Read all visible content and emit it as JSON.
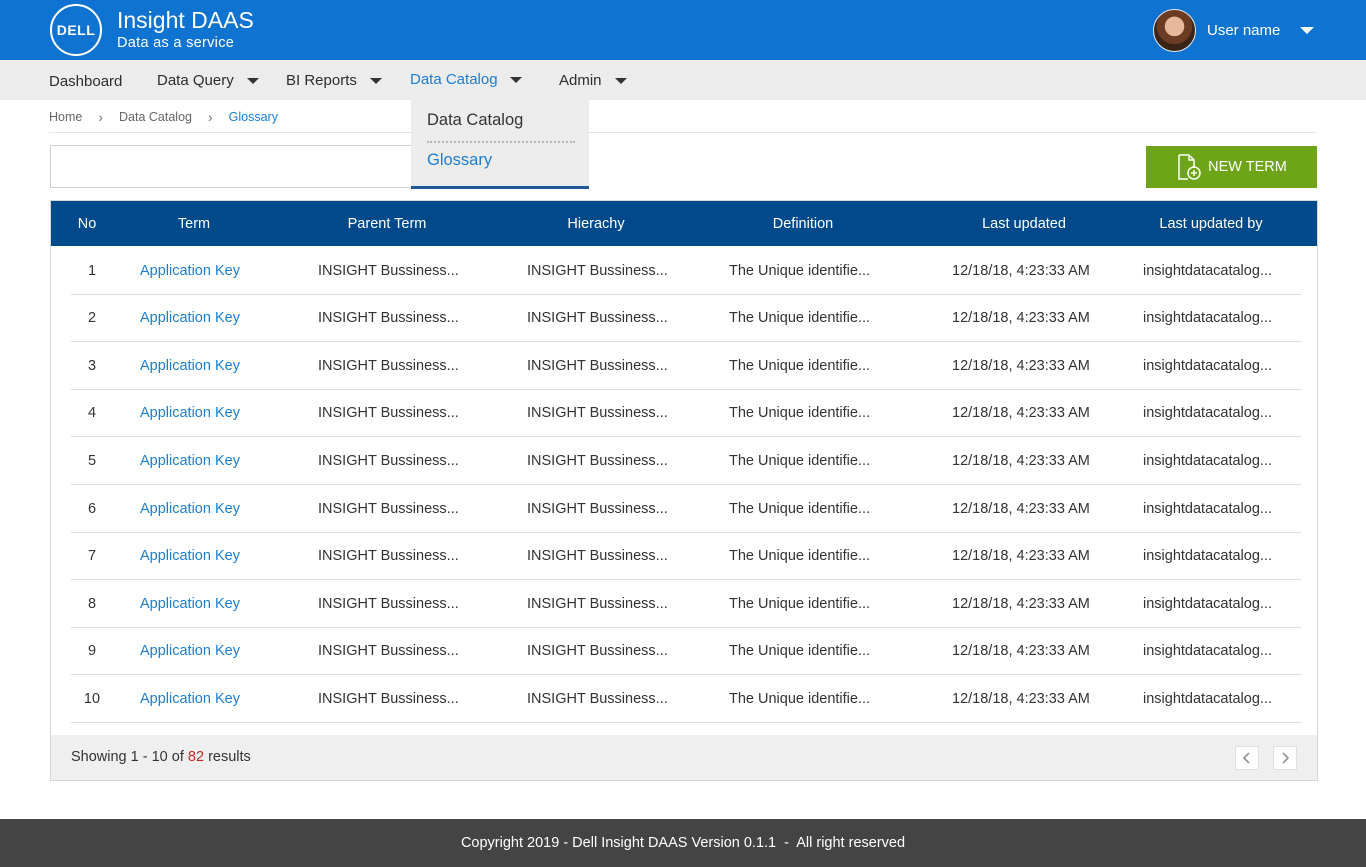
{
  "header": {
    "logo_text": "DELL",
    "title": "Insight DAAS",
    "subtitle": "Data as a service",
    "user_name": "User name"
  },
  "nav": {
    "items": [
      {
        "label": "Dashboard"
      },
      {
        "label": "Data Query"
      },
      {
        "label": "BI Reports"
      },
      {
        "label": "Data Catalog"
      },
      {
        "label": "Admin"
      }
    ],
    "active": "Data Catalog"
  },
  "dropdown": {
    "items": [
      {
        "label": "Data Catalog"
      },
      {
        "label": "Glossary"
      }
    ]
  },
  "breadcrumb": {
    "items": [
      "Home",
      "Data Catalog",
      "Glossary"
    ]
  },
  "search": {
    "value": "",
    "placeholder": ""
  },
  "actions": {
    "new_term_label": "NEW TERM"
  },
  "table": {
    "columns": [
      "No",
      "Term",
      "Parent Term",
      "Hierachy",
      "Definition",
      "Last updated",
      "Last updated by"
    ],
    "rows": [
      {
        "no": "1",
        "term": "Application Key",
        "parent": "INSIGHT Bussiness...",
        "hier": "INSIGHT Bussiness...",
        "def": "The Unique identifie...",
        "updated": "12/18/18, 4:23:33 AM",
        "by": "insightdatacatalog..."
      },
      {
        "no": "2",
        "term": "Application Key",
        "parent": "INSIGHT Bussiness...",
        "hier": "INSIGHT Bussiness...",
        "def": "The Unique identifie...",
        "updated": "12/18/18, 4:23:33 AM",
        "by": "insightdatacatalog..."
      },
      {
        "no": "3",
        "term": "Application Key",
        "parent": "INSIGHT Bussiness...",
        "hier": "INSIGHT Bussiness...",
        "def": "The Unique identifie...",
        "updated": "12/18/18, 4:23:33 AM",
        "by": "insightdatacatalog..."
      },
      {
        "no": "4",
        "term": "Application Key",
        "parent": "INSIGHT Bussiness...",
        "hier": "INSIGHT Bussiness...",
        "def": "The Unique identifie...",
        "updated": "12/18/18, 4:23:33 AM",
        "by": "insightdatacatalog..."
      },
      {
        "no": "5",
        "term": "Application Key",
        "parent": "INSIGHT Bussiness...",
        "hier": "INSIGHT Bussiness...",
        "def": "The Unique identifie...",
        "updated": "12/18/18, 4:23:33 AM",
        "by": "insightdatacatalog..."
      },
      {
        "no": "6",
        "term": "Application Key",
        "parent": "INSIGHT Bussiness...",
        "hier": "INSIGHT Bussiness...",
        "def": "The Unique identifie...",
        "updated": "12/18/18, 4:23:33 AM",
        "by": "insightdatacatalog..."
      },
      {
        "no": "7",
        "term": "Application Key",
        "parent": "INSIGHT Bussiness...",
        "hier": "INSIGHT Bussiness...",
        "def": "The Unique identifie...",
        "updated": "12/18/18, 4:23:33 AM",
        "by": "insightdatacatalog..."
      },
      {
        "no": "8",
        "term": "Application Key",
        "parent": "INSIGHT Bussiness...",
        "hier": "INSIGHT Bussiness...",
        "def": "The Unique identifie...",
        "updated": "12/18/18, 4:23:33 AM",
        "by": "insightdatacatalog..."
      },
      {
        "no": "9",
        "term": "Application Key",
        "parent": "INSIGHT Bussiness...",
        "hier": "INSIGHT Bussiness...",
        "def": "The Unique identifie...",
        "updated": "12/18/18, 4:23:33 AM",
        "by": "insightdatacatalog..."
      },
      {
        "no": "10",
        "term": "Application Key",
        "parent": "INSIGHT Bussiness...",
        "hier": "INSIGHT Bussiness...",
        "def": "The Unique identifie...",
        "updated": "12/18/18, 4:23:33 AM",
        "by": "insightdatacatalog..."
      }
    ]
  },
  "pagination": {
    "prefix": "Showing 1 - 10 of",
    "total": "82",
    "suffix": "results"
  },
  "footer": {
    "text": "Copyright 2019 - Dell Insight DAAS Version 0.1.1  -  All right reserved"
  },
  "colors": {
    "header_blue": "#0f74d1",
    "table_header": "#004a8b",
    "link_blue": "#1a7fd4",
    "button_green": "#6ea418",
    "total_red": "#c62828",
    "footer_bg": "#444444"
  },
  "icons": [
    "dell-logo",
    "chevron-right-icon",
    "caret-down-icon",
    "add-document-icon",
    "chevron-left-icon",
    "user-avatar"
  ]
}
